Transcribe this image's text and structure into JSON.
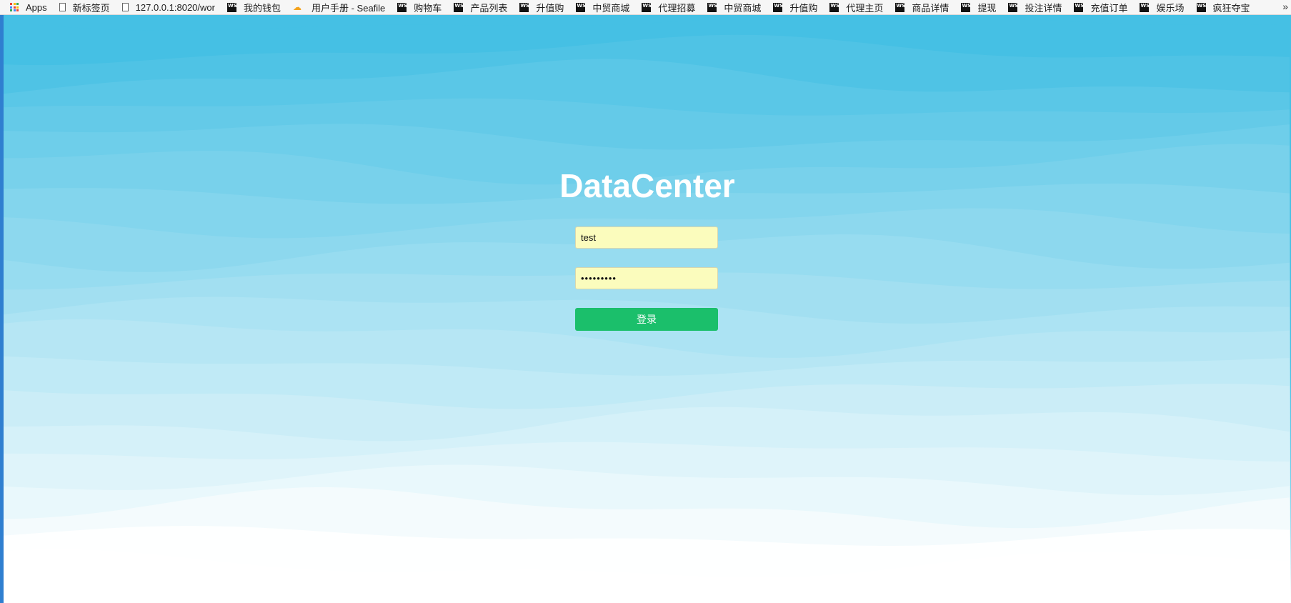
{
  "bookmarks": [
    {
      "label": "Apps",
      "icon": "apps-icon"
    },
    {
      "label": "新标签页",
      "icon": "page-icon"
    },
    {
      "label": "127.0.0.1:8020/wor",
      "icon": "page-icon"
    },
    {
      "label": "我的钱包",
      "icon": "webstorm-icon"
    },
    {
      "label": "用户手册 - Seafile",
      "icon": "seafile-icon"
    },
    {
      "label": "购物车",
      "icon": "webstorm-icon"
    },
    {
      "label": "产品列表",
      "icon": "webstorm-icon"
    },
    {
      "label": "升值购",
      "icon": "webstorm-icon"
    },
    {
      "label": "中贸商城",
      "icon": "webstorm-icon"
    },
    {
      "label": "代理招募",
      "icon": "webstorm-icon"
    },
    {
      "label": "中贸商城",
      "icon": "webstorm-icon"
    },
    {
      "label": "升值购",
      "icon": "webstorm-icon"
    },
    {
      "label": "代理主页",
      "icon": "webstorm-icon"
    },
    {
      "label": "商品详情",
      "icon": "webstorm-icon"
    },
    {
      "label": "提现",
      "icon": "webstorm-icon"
    },
    {
      "label": "投注详情",
      "icon": "webstorm-icon"
    },
    {
      "label": "充值订单",
      "icon": "webstorm-icon"
    },
    {
      "label": "娱乐场",
      "icon": "webstorm-icon"
    },
    {
      "label": "疯狂夺宝",
      "icon": "webstorm-icon"
    }
  ],
  "bookmarks_overflow": "»",
  "ws_icon_text": "WS",
  "login": {
    "title": "DataCenter",
    "username_value": "test",
    "password_value": "123456789",
    "submit_label": "登录"
  },
  "colors": {
    "sky_top": "#45c0e4",
    "sky_bottom": "#ffffff",
    "button": "#1bbf6b",
    "input_bg": "#fbfcbd"
  }
}
